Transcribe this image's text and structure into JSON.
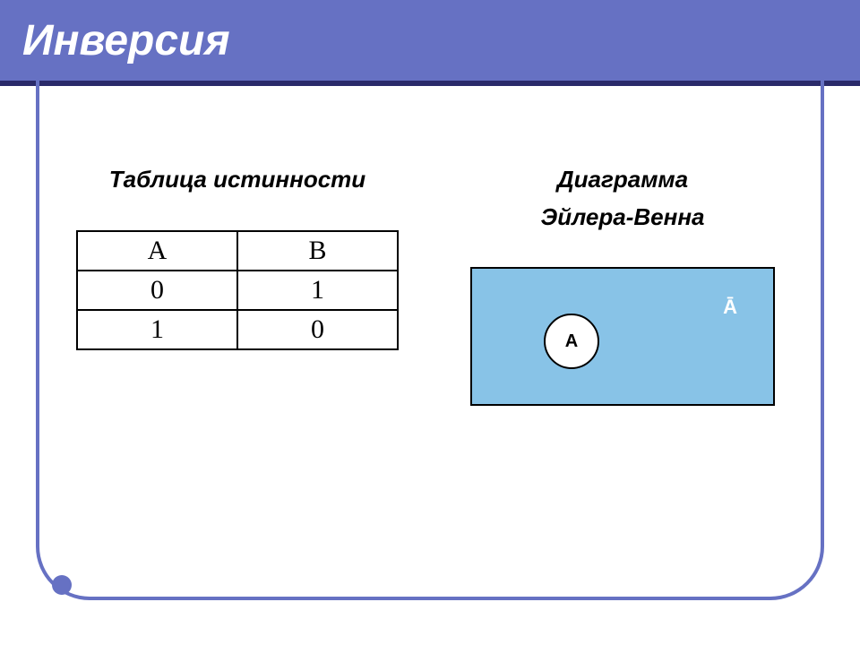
{
  "title": "Инверсия",
  "left": {
    "heading": "Таблица истинности",
    "table": {
      "head_a": "A",
      "head_b": "B",
      "row1_a": "0",
      "row1_b": "1",
      "row2_a": "1",
      "row2_b": "0"
    }
  },
  "right": {
    "heading_line1": "Диаграмма",
    "heading_line2": "Эйлера-Венна",
    "circle_label": "А",
    "outer_label": "Ā"
  },
  "chart_data": {
    "type": "table",
    "title": "Таблица истинности (Инверсия)",
    "columns": [
      "A",
      "B"
    ],
    "rows": [
      [
        0,
        1
      ],
      [
        1,
        0
      ]
    ],
    "venn": {
      "universe_label": "Ā",
      "set_label": "А",
      "shaded_region": "complement_of_A"
    }
  }
}
